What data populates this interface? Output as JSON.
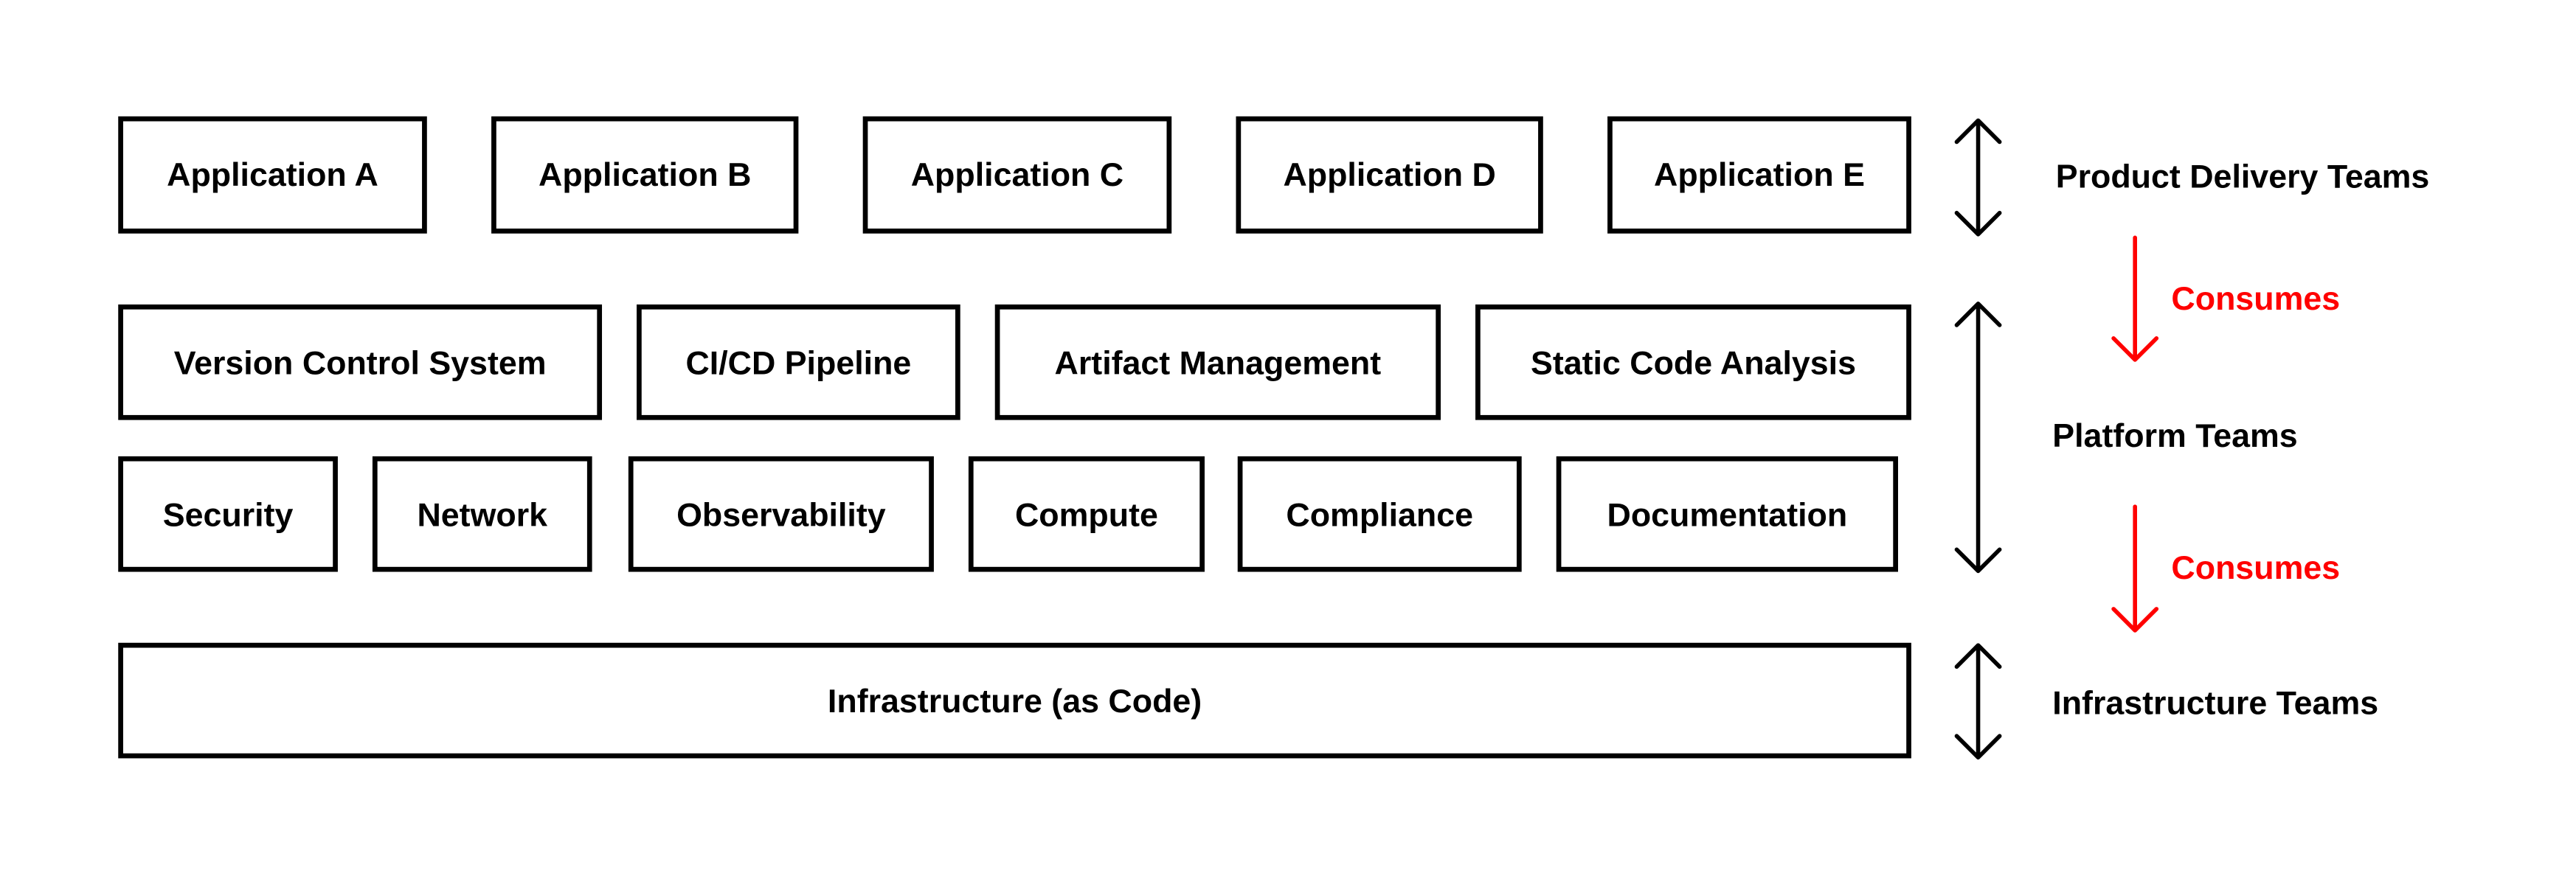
{
  "layers": {
    "applications": [
      "Application A",
      "Application B",
      "Application C",
      "Application D",
      "Application E"
    ],
    "platform_row1": [
      "Version Control System",
      "CI/CD Pipeline",
      "Artifact Management",
      "Static Code Analysis"
    ],
    "platform_row2": [
      "Security",
      "Network",
      "Observability",
      "Compute",
      "Compliance",
      "Documentation"
    ],
    "infrastructure": "Infrastructure (as Code)"
  },
  "teams": {
    "product": "Product Delivery Teams",
    "platform": "Platform Teams",
    "infrastructure": "Infrastructure Teams"
  },
  "relations": {
    "consumes_1": "Consumes",
    "consumes_2": "Consumes"
  },
  "colors": {
    "accent": "#ff0000",
    "line": "#000000"
  }
}
